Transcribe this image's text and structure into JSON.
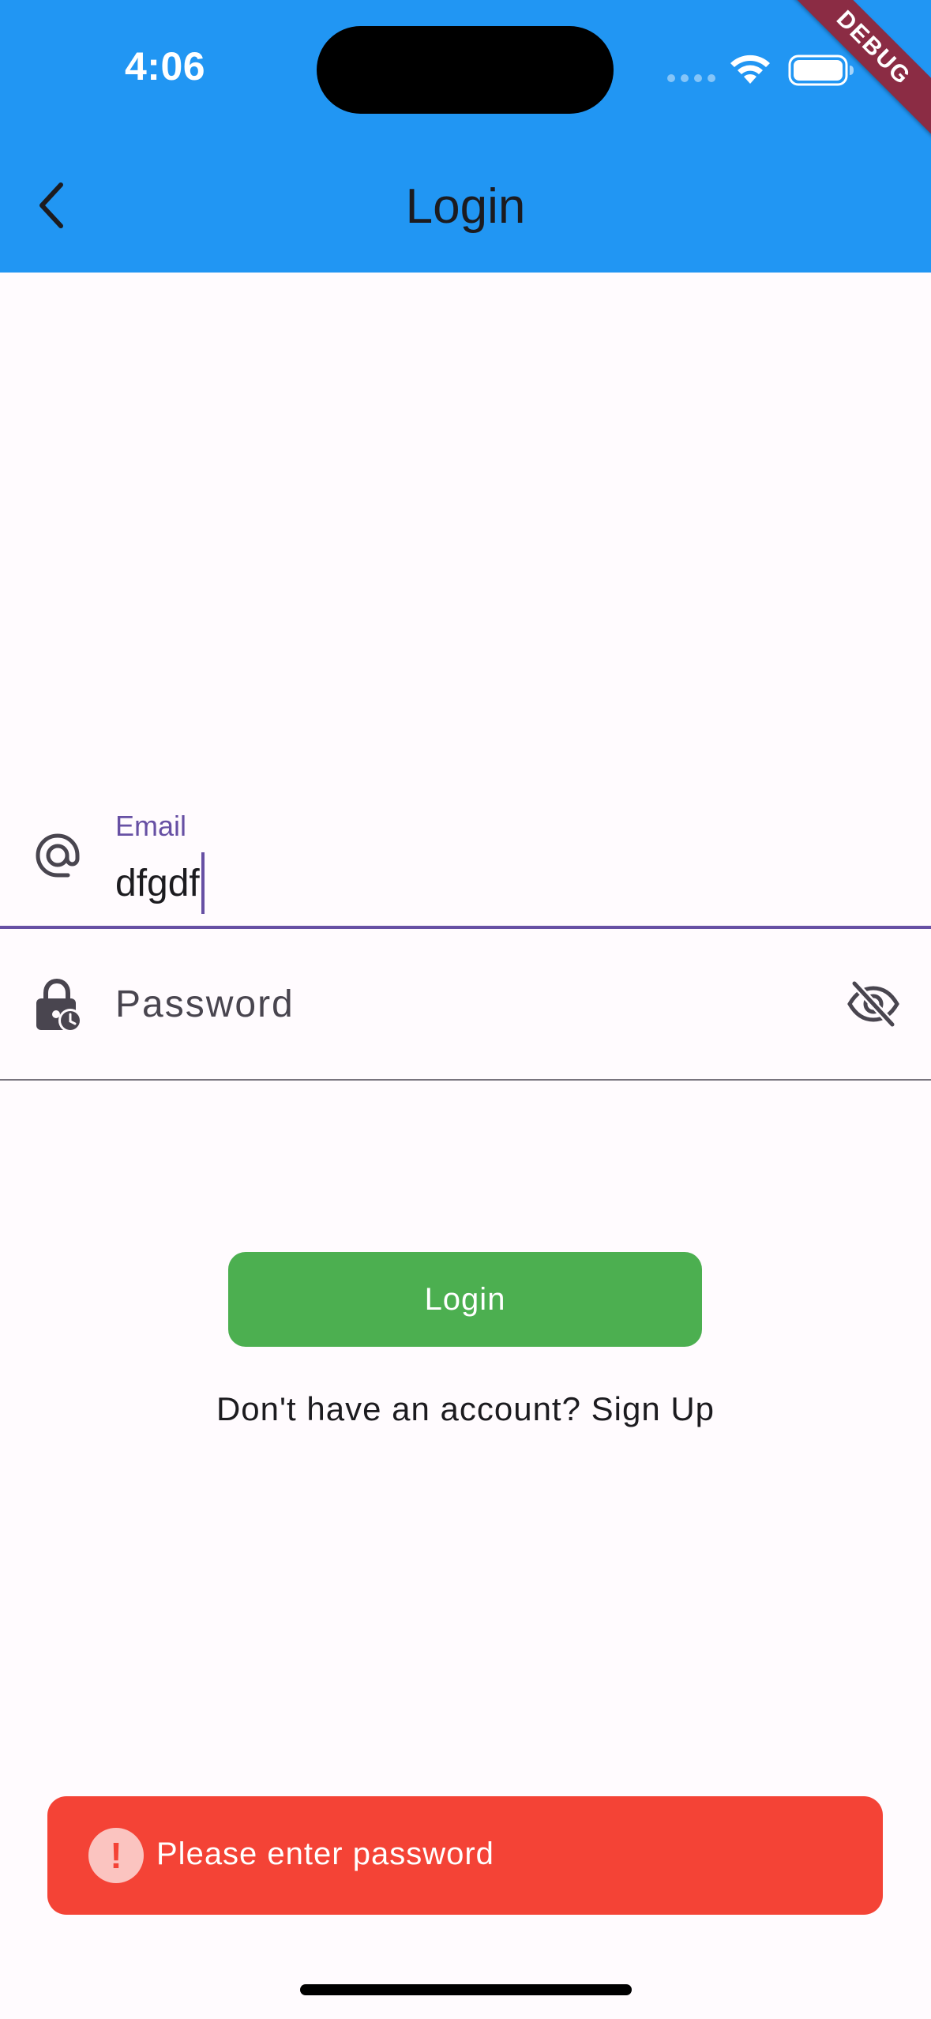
{
  "status_bar": {
    "time": "4:06"
  },
  "debug_banner": "DEBUG",
  "app_bar": {
    "title": "Login",
    "back_icon": "chevron-left-icon"
  },
  "email_field": {
    "label": "Email",
    "value": "dfgdf",
    "icon": "at-sign-icon"
  },
  "password_field": {
    "placeholder": "Password",
    "icon": "lock-clock-icon",
    "toggle_icon": "visibility-off-icon"
  },
  "login_button": {
    "label": "Login"
  },
  "signup_link": {
    "text": "Don't have an account? Sign Up"
  },
  "snackbar": {
    "message": "Please enter password",
    "icon_glyph": "!",
    "icon": "error-icon"
  },
  "colors": {
    "app_bar": "#2196f3",
    "primary": "#6750a4",
    "login_button": "#4caf50",
    "snackbar": "#f44336",
    "background": "#fffbfe"
  }
}
